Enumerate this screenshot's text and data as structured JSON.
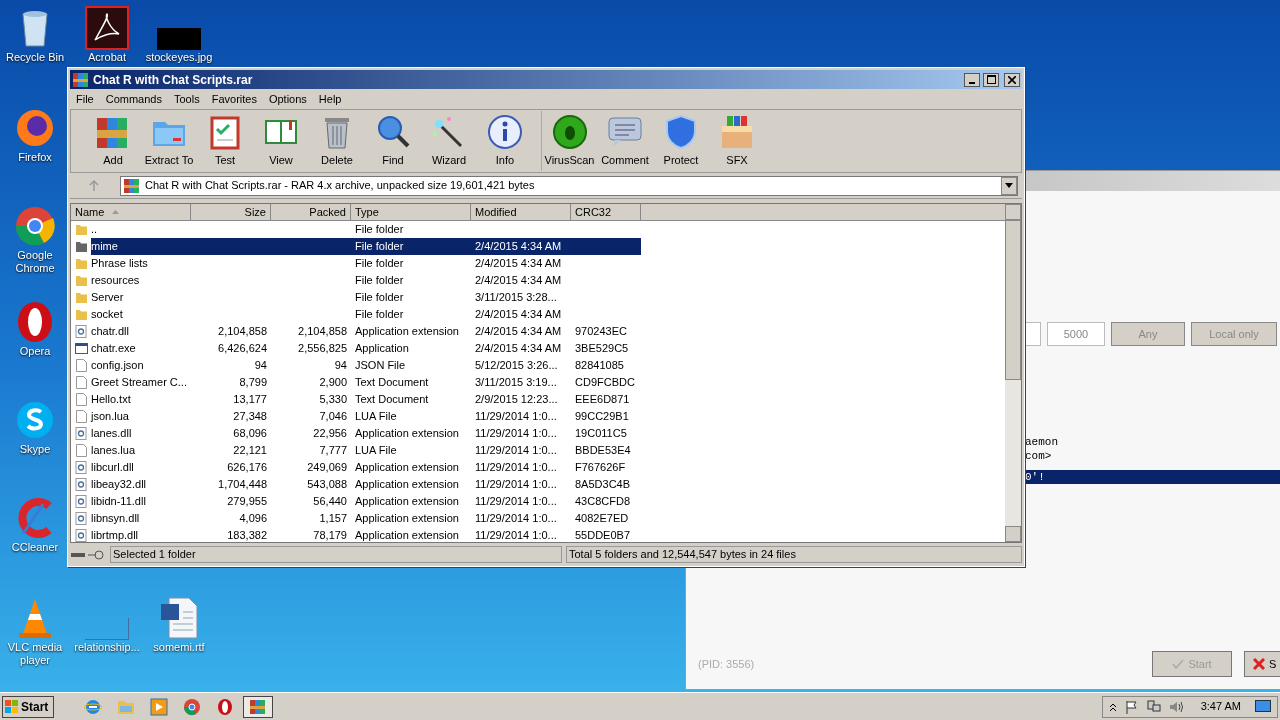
{
  "desktop_icons": [
    {
      "label": "Recycle Bin",
      "kind": "recycle"
    },
    {
      "label": "Acrobat",
      "kind": "acrobat"
    },
    {
      "label": "stockeyes.jpg",
      "kind": "redacted"
    },
    {
      "label": "Firefox",
      "kind": "firefox"
    },
    {
      "label": "Google Chrome",
      "kind": "chrome"
    },
    {
      "label": "Opera",
      "kind": "opera"
    },
    {
      "label": "Skype",
      "kind": "skype"
    },
    {
      "label": "CCleaner",
      "kind": "ccleaner"
    },
    {
      "label": "VLC media player",
      "kind": "vlc"
    },
    {
      "label": "relationship...",
      "kind": "blank"
    },
    {
      "label": "somemi.rtf",
      "kind": "word"
    }
  ],
  "back_window": {
    "fields": [
      "5000"
    ],
    "buttons": [
      "Any",
      "Local only"
    ],
    "console_lines": [
      "aemon",
      "com>"
    ],
    "highlighted_line": "0'!",
    "pid": "(PID: 3556)",
    "start_button": "Start",
    "stop_button": "S"
  },
  "window": {
    "title": "Chat R with Chat Scripts.rar",
    "menu": [
      "File",
      "Commands",
      "Tools",
      "Favorites",
      "Options",
      "Help"
    ],
    "toolbar": [
      {
        "label": "Add",
        "kind": "add"
      },
      {
        "label": "Extract To",
        "kind": "extract"
      },
      {
        "label": "Test",
        "kind": "test"
      },
      {
        "label": "View",
        "kind": "view"
      },
      {
        "label": "Delete",
        "kind": "delete"
      },
      {
        "label": "Find",
        "kind": "find"
      },
      {
        "label": "Wizard",
        "kind": "wizard"
      },
      {
        "label": "Info",
        "kind": "info"
      },
      {
        "label": "VirusScan",
        "kind": "virus"
      },
      {
        "label": "Comment",
        "kind": "comment"
      },
      {
        "label": "Protect",
        "kind": "protect"
      },
      {
        "label": "SFX",
        "kind": "sfx"
      }
    ],
    "address": "Chat R with Chat Scripts.rar - RAR 4.x archive, unpacked size 19,601,421 bytes",
    "columns": [
      "Name",
      "Size",
      "Packed",
      "Type",
      "Modified",
      "CRC32"
    ],
    "rows": [
      {
        "kind": "folder",
        "selected": false,
        "cells": [
          "..",
          "",
          "",
          "File folder",
          "",
          ""
        ]
      },
      {
        "kind": "folder",
        "selected": true,
        "cells": [
          "mime",
          "",
          "",
          "File folder",
          "2/4/2015 4:34 AM",
          ""
        ]
      },
      {
        "kind": "folder",
        "selected": false,
        "cells": [
          "Phrase lists",
          "",
          "",
          "File folder",
          "2/4/2015 4:34 AM",
          ""
        ]
      },
      {
        "kind": "folder",
        "selected": false,
        "cells": [
          "resources",
          "",
          "",
          "File folder",
          "2/4/2015 4:34 AM",
          ""
        ]
      },
      {
        "kind": "folder",
        "selected": false,
        "cells": [
          "Server",
          "",
          "",
          "File folder",
          "3/11/2015 3:28...",
          ""
        ]
      },
      {
        "kind": "folder",
        "selected": false,
        "cells": [
          "socket",
          "",
          "",
          "File folder",
          "2/4/2015 4:34 AM",
          ""
        ]
      },
      {
        "kind": "dll",
        "selected": false,
        "cells": [
          "chatr.dll",
          "2,104,858",
          "2,104,858",
          "Application extension",
          "2/4/2015 4:34 AM",
          "970243EC"
        ]
      },
      {
        "kind": "exe",
        "selected": false,
        "cells": [
          "chatr.exe",
          "6,426,624",
          "2,556,825",
          "Application",
          "2/4/2015 4:34 AM",
          "3BE529C5"
        ]
      },
      {
        "kind": "file",
        "selected": false,
        "cells": [
          "config.json",
          "94",
          "94",
          "JSON File",
          "5/12/2015 3:26...",
          "82841085"
        ]
      },
      {
        "kind": "file",
        "selected": false,
        "cells": [
          "Greet Streamer C...",
          "8,799",
          "2,900",
          "Text Document",
          "3/11/2015 3:19...",
          "CD9FCBDC"
        ]
      },
      {
        "kind": "file",
        "selected": false,
        "cells": [
          "Hello.txt",
          "13,177",
          "5,330",
          "Text Document",
          "2/9/2015 12:23...",
          "EEE6D871"
        ]
      },
      {
        "kind": "file",
        "selected": false,
        "cells": [
          "json.lua",
          "27,348",
          "7,046",
          "LUA File",
          "11/29/2014 1:0...",
          "99CC29B1"
        ]
      },
      {
        "kind": "dll",
        "selected": false,
        "cells": [
          "lanes.dll",
          "68,096",
          "22,956",
          "Application extension",
          "11/29/2014 1:0...",
          "19C011C5"
        ]
      },
      {
        "kind": "file",
        "selected": false,
        "cells": [
          "lanes.lua",
          "22,121",
          "7,777",
          "LUA File",
          "11/29/2014 1:0...",
          "BBDE53E4"
        ]
      },
      {
        "kind": "dll",
        "selected": false,
        "cells": [
          "libcurl.dll",
          "626,176",
          "249,069",
          "Application extension",
          "11/29/2014 1:0...",
          "F767626F"
        ]
      },
      {
        "kind": "dll",
        "selected": false,
        "cells": [
          "libeay32.dll",
          "1,704,448",
          "543,088",
          "Application extension",
          "11/29/2014 1:0...",
          "8A5D3C4B"
        ]
      },
      {
        "kind": "dll",
        "selected": false,
        "cells": [
          "libidn-11.dll",
          "279,955",
          "56,440",
          "Application extension",
          "11/29/2014 1:0...",
          "43C8CFD8"
        ]
      },
      {
        "kind": "dll",
        "selected": false,
        "cells": [
          "libnsyn.dll",
          "4,096",
          "1,157",
          "Application extension",
          "11/29/2014 1:0...",
          "4082E7ED"
        ]
      },
      {
        "kind": "dll",
        "selected": false,
        "cells": [
          "librtmp.dll",
          "183,382",
          "78,179",
          "Application extension",
          "11/29/2014 1:0...",
          "55DDE0B7"
        ]
      }
    ],
    "status_left": "Selected 1 folder",
    "status_right": "Total 5 folders and 12,544,547 bytes in 24 files"
  },
  "taskbar": {
    "start": "Start",
    "pinned": [
      {
        "kind": "ie",
        "active": false
      },
      {
        "kind": "explorer",
        "active": false
      },
      {
        "kind": "media",
        "active": false
      },
      {
        "kind": "chrome",
        "active": false
      },
      {
        "kind": "opera",
        "active": false
      },
      {
        "kind": "winrar",
        "active": true
      }
    ],
    "time": "3:47 AM"
  }
}
